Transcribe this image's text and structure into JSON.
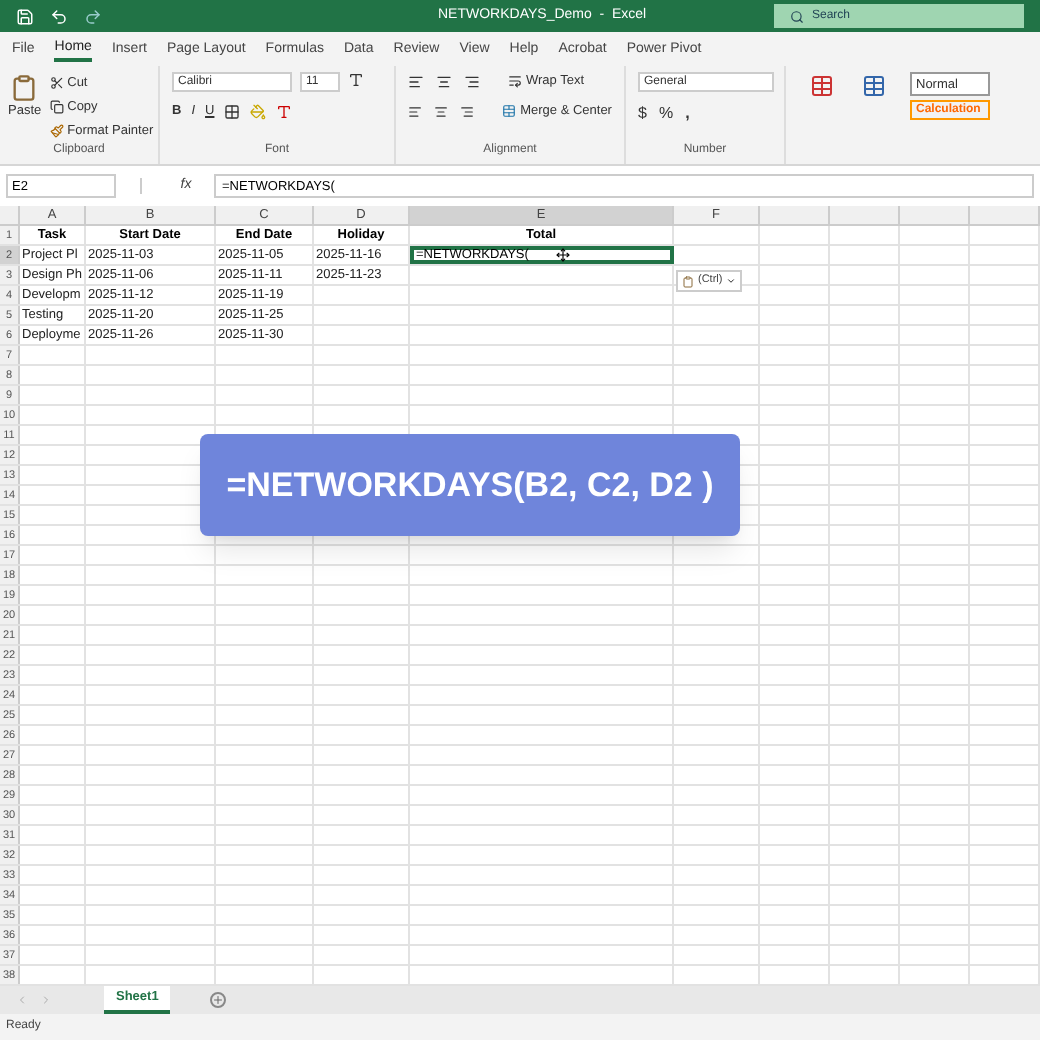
{
  "title_bar": {
    "title": "NETWORKDAYS_Demo  -  Excel",
    "search_placeholder": "Search"
  },
  "menu_tabs": [
    {
      "label": "File",
      "selected": false
    },
    {
      "label": "Home",
      "selected": true
    },
    {
      "label": "Insert",
      "selected": false
    },
    {
      "label": "Page Layout",
      "selected": false
    },
    {
      "label": "Formulas",
      "selected": false
    },
    {
      "label": "Data",
      "selected": false
    },
    {
      "label": "Review",
      "selected": false
    },
    {
      "label": "View",
      "selected": false
    },
    {
      "label": "Help",
      "selected": false
    },
    {
      "label": "Acrobat",
      "selected": false
    },
    {
      "label": "Power Pivot",
      "selected": false
    }
  ],
  "ribbon": {
    "clipboard": {
      "paste": "Paste",
      "cut": "Cut",
      "copy": "Copy",
      "format_painter": "Format Painter",
      "label": "Clipboard"
    },
    "font": {
      "name": "Calibri",
      "size": "11",
      "label": "Font",
      "bold": "B",
      "italic": "I",
      "underline": "U"
    },
    "alignment": {
      "wrap_text": "Wrap Text",
      "merge": "Merge & Center",
      "label": "Alignment"
    },
    "number": {
      "format": "General",
      "currency": "$",
      "percent": "%",
      "comma": ",",
      "label": "Number"
    },
    "styles": {
      "normal": "Normal",
      "calculation": "Calculation"
    }
  },
  "formula_bar": {
    "name_box": "E2",
    "function_label": "fx",
    "formula": "=NETWORKDAYS("
  },
  "columns": [
    "A",
    "B",
    "C",
    "D",
    "E",
    "F"
  ],
  "row_numbers": [
    "1",
    "2",
    "3",
    "4",
    "5",
    "6",
    "7",
    "8",
    "9",
    "10",
    "11",
    "12",
    "13",
    "14",
    "15",
    "16",
    "17",
    "18",
    "19",
    "20",
    "21",
    "22",
    "23",
    "24",
    "25",
    "26",
    "27",
    "28",
    "29",
    "30",
    "31",
    "32",
    "33",
    "34",
    "35",
    "36",
    "37",
    "38"
  ],
  "table": {
    "header": [
      "Task",
      "Start Date",
      "End Date",
      "Holiday",
      "Total"
    ],
    "rows": [
      {
        "cells": [
          "Project Pl",
          "2025-11-03",
          "2025-11-05",
          "2025-11-16",
          "=NETWORKDAYS("
        ],
        "selected": true
      },
      {
        "cells": [
          "Design Ph",
          "2025-11-06",
          "2025-11-11",
          "2025-11-23",
          ""
        ],
        "selected": false
      },
      {
        "cells": [
          "Developm",
          "2025-11-12",
          "2025-11-19",
          "",
          ""
        ],
        "selected": false
      },
      {
        "cells": [
          "Testing",
          "2025-11-20",
          "2025-11-25",
          "",
          ""
        ],
        "selected": false
      },
      {
        "cells": [
          "Deployme",
          "2025-11-26",
          "2025-11-30",
          "",
          ""
        ],
        "selected": false
      }
    ]
  },
  "paste_options": "(Ctrl)",
  "overlay": "=NETWORKDAYS(B2, C2, D2 )",
  "sheet_tabs": [
    {
      "label": "Sheet1",
      "selected": true
    }
  ],
  "status_bar": "Ready"
}
